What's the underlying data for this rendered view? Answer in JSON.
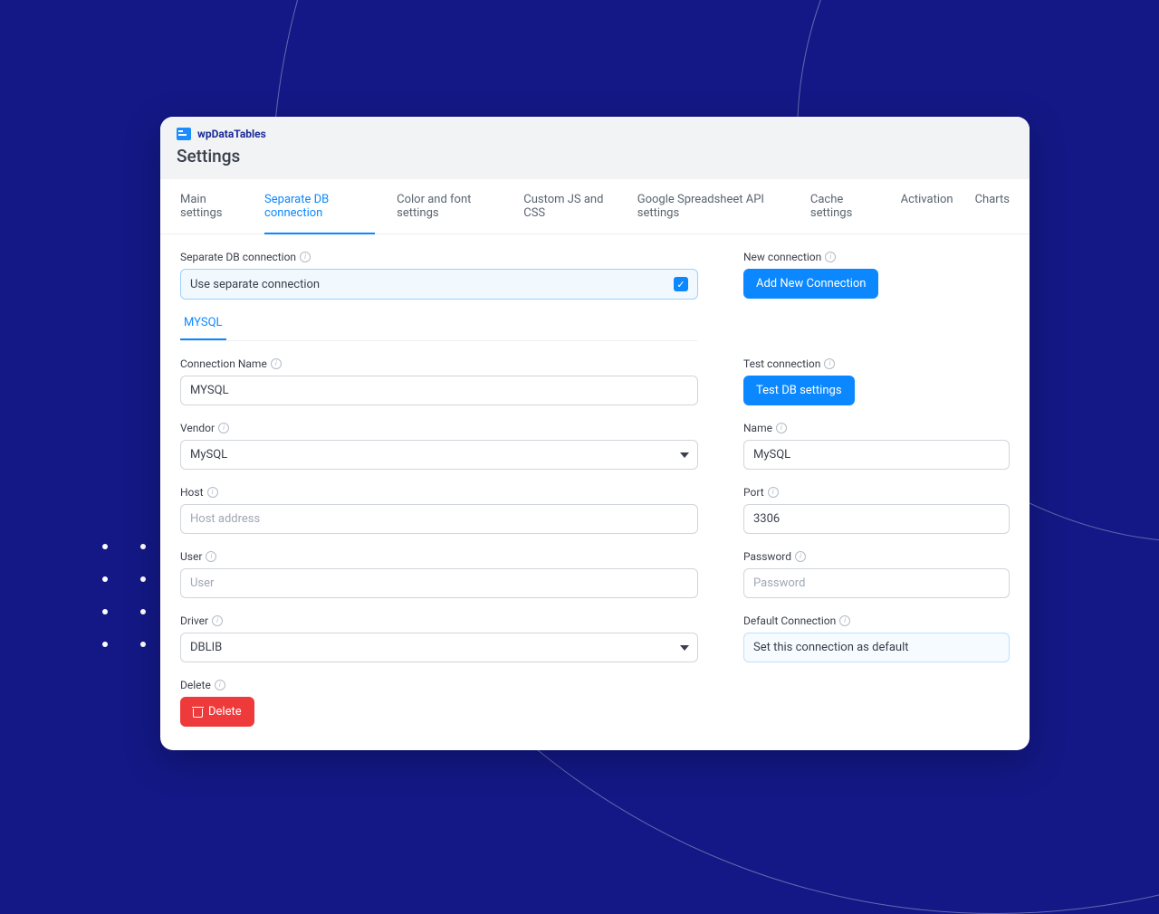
{
  "brand": {
    "name": "wpDataTables"
  },
  "page_title": "Settings",
  "tabs": {
    "items": [
      "Main settings",
      "Separate DB connection",
      "Color and font settings",
      "Custom JS and CSS",
      "Google Spreadsheet API settings",
      "Cache settings",
      "Activation",
      "Charts"
    ],
    "active_index": 1
  },
  "separate_db": {
    "label": "Separate DB connection",
    "toggle_text": "Use separate connection"
  },
  "new_connection": {
    "label": "New connection",
    "button": "Add New Connection"
  },
  "subtab": "MYSQL",
  "connection_name": {
    "label": "Connection Name",
    "value": "MYSQL"
  },
  "test": {
    "label": "Test connection",
    "button": "Test DB settings"
  },
  "vendor": {
    "label": "Vendor",
    "value": "MySQL"
  },
  "name": {
    "label": "Name",
    "value": "MySQL"
  },
  "host": {
    "label": "Host",
    "placeholder": "Host address",
    "value": ""
  },
  "port": {
    "label": "Port",
    "value": "3306"
  },
  "user": {
    "label": "User",
    "placeholder": "User",
    "value": ""
  },
  "password": {
    "label": "Password",
    "placeholder": "Password",
    "value": ""
  },
  "driver": {
    "label": "Driver",
    "value": "DBLIB"
  },
  "default_conn": {
    "label": "Default Connection",
    "text": "Set this connection as default"
  },
  "delete": {
    "label": "Delete",
    "button": "Delete"
  }
}
